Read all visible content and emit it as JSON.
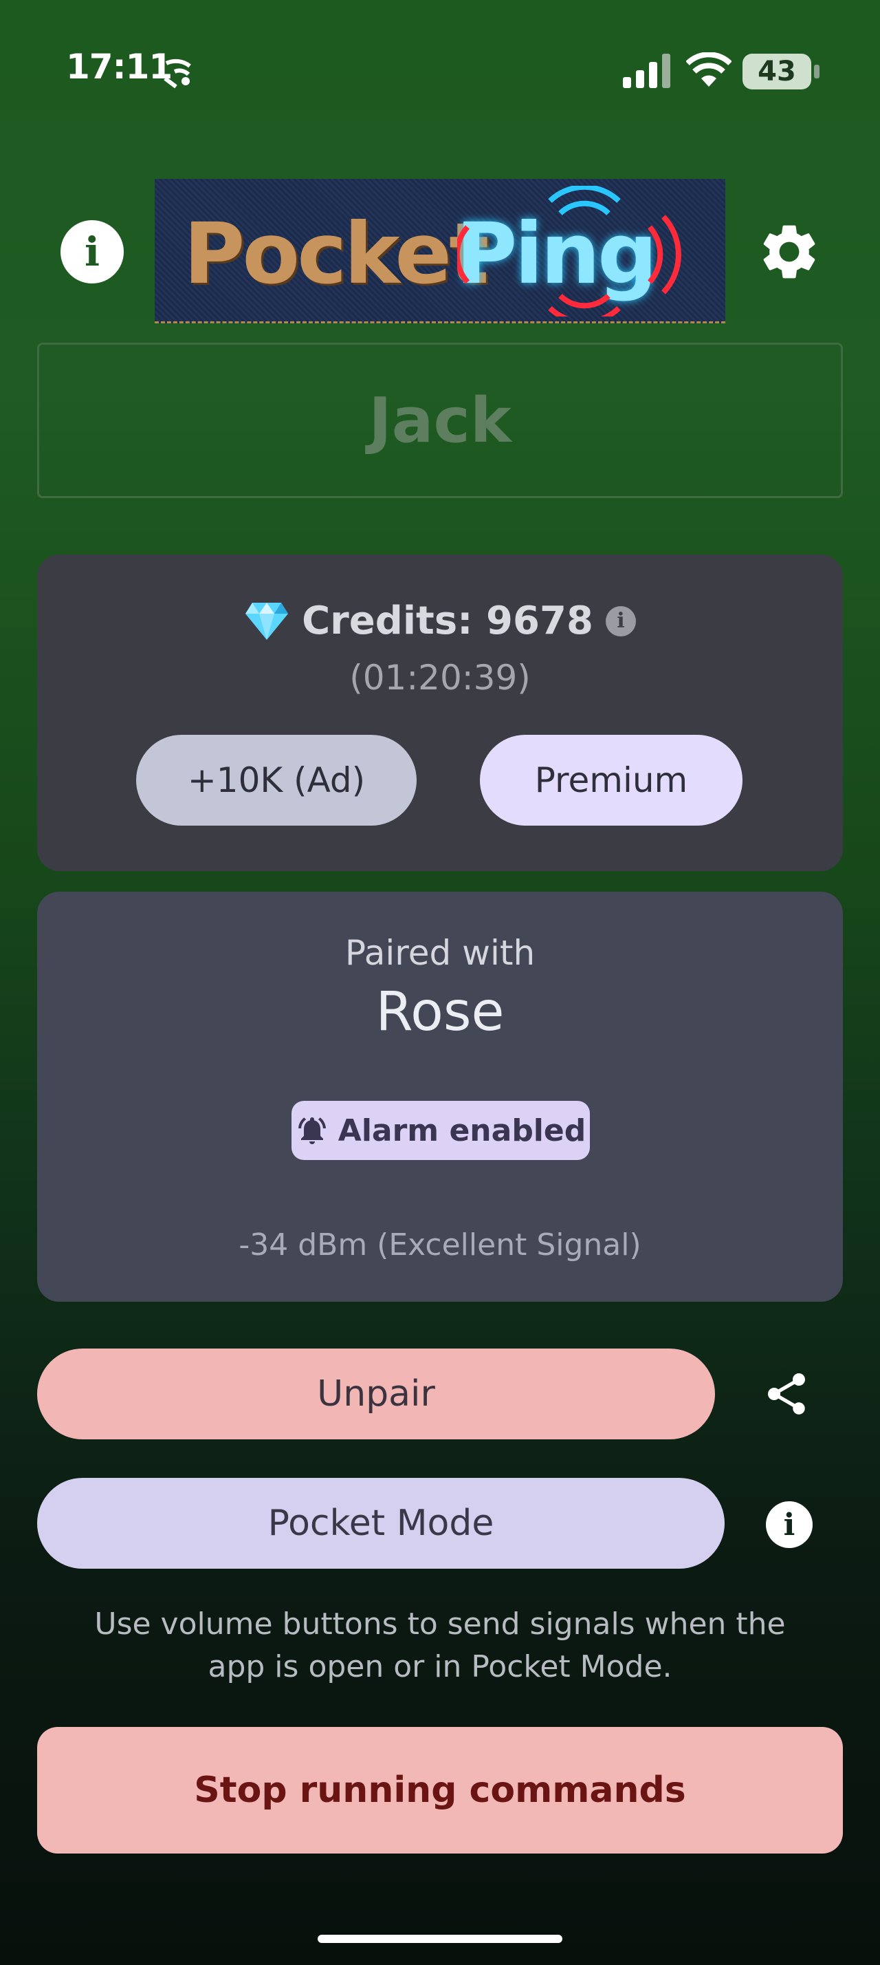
{
  "status_bar": {
    "time": "17:11",
    "battery": "43"
  },
  "header": {
    "logo_text_1": "Pocket",
    "logo_text_2": "Ping"
  },
  "name_field": {
    "value": "Jack"
  },
  "credits": {
    "icon": "gem-icon",
    "label": "Credits: 9678",
    "timer": "(01:20:39)",
    "ad_button": "+10K (Ad)",
    "premium_button": "Premium"
  },
  "pairing": {
    "label": "Paired with",
    "partner": "Rose",
    "alarm_chip": "Alarm enabled",
    "signal": "-34 dBm (Excellent Signal)"
  },
  "actions": {
    "unpair": "Unpair",
    "pocket_mode": "Pocket Mode",
    "hint": "Use volume buttons to send signals when the app is open or in Pocket Mode.",
    "stop": "Stop running commands"
  },
  "colors": {
    "bg_top": "#1d5a20",
    "bg_bottom": "#08100c",
    "unpair": "#f2b7b5",
    "pocket_mode": "#d6d0f0",
    "stop": "#f1b8b6"
  }
}
